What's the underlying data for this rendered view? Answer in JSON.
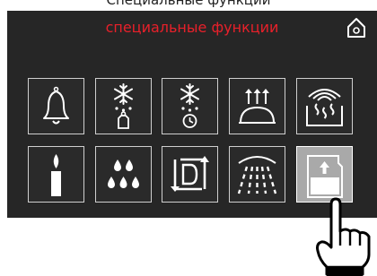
{
  "header": {
    "cut_title": "Специальные функции",
    "title": "специальные функции",
    "title_color": "#e8202a",
    "home_icon": "home-icon"
  },
  "tiles": [
    {
      "name": "tile-timer-bell",
      "icon": "bell-icon"
    },
    {
      "name": "tile-defrost-weight",
      "icon": "snowflake-weight-icon"
    },
    {
      "name": "tile-defrost-time",
      "icon": "snowflake-clock-icon"
    },
    {
      "name": "tile-proving",
      "icon": "dough-rising-icon"
    },
    {
      "name": "tile-warm-plates",
      "icon": "plate-warming-icon"
    },
    {
      "name": "tile-candle",
      "icon": "candle-icon"
    },
    {
      "name": "tile-drying",
      "icon": "drops-icon"
    },
    {
      "name": "tile-descale",
      "icon": "descale-d-icon"
    },
    {
      "name": "tile-rinse",
      "icon": "spray-icon"
    },
    {
      "name": "tile-fill-water",
      "icon": "water-tank-icon",
      "selected": true
    }
  ],
  "colors": {
    "screen": "#262626",
    "icon": "#ffffff",
    "selected_tile": "#a9a9a9"
  }
}
